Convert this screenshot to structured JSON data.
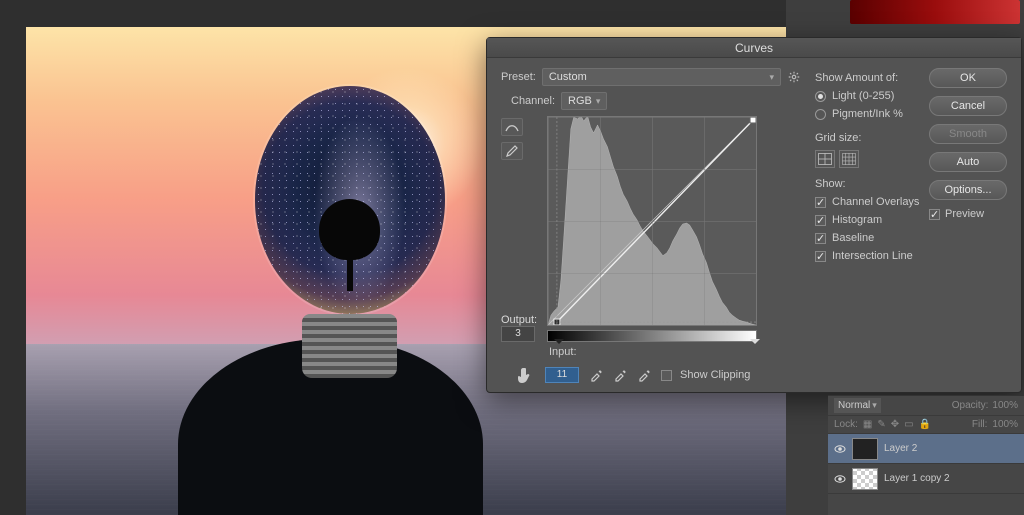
{
  "dialog": {
    "title": "Curves",
    "preset_label": "Preset:",
    "preset_value": "Custom",
    "channel_label": "Channel:",
    "channel_value": "RGB",
    "output_label": "Output:",
    "output_value": "3",
    "input_label": "Input:",
    "input_value": "11",
    "show_clipping_label": "Show Clipping",
    "show_clipping_checked": false
  },
  "amount": {
    "title": "Show Amount of:",
    "light_label": "Light  (0-255)",
    "pigment_label": "Pigment/Ink %"
  },
  "gridsize_label": "Grid size:",
  "show": {
    "title": "Show:",
    "channel_overlays": "Channel Overlays",
    "histogram": "Histogram",
    "baseline": "Baseline",
    "intersection": "Intersection Line"
  },
  "buttons": {
    "ok": "OK",
    "cancel": "Cancel",
    "smooth": "Smooth",
    "auto": "Auto",
    "options": "Options...",
    "preview": "Preview"
  },
  "layers_panel": {
    "blend": "Normal",
    "opacity_label": "Opacity:",
    "opacity_value": "100%",
    "lock_label": "Lock:",
    "fill_label": "Fill:",
    "fill_value": "100%",
    "items": [
      {
        "name": "Layer 2"
      },
      {
        "name": "Layer 1 copy 2"
      }
    ]
  },
  "chart_data": {
    "type": "line",
    "title": "Curves",
    "xlabel": "Input",
    "ylabel": "Output",
    "xlim": [
      0,
      255
    ],
    "ylim": [
      0,
      255
    ],
    "series": [
      {
        "name": "Curve",
        "x": [
          11,
          255
        ],
        "y": [
          3,
          255
        ]
      },
      {
        "name": "Baseline",
        "x": [
          0,
          255
        ],
        "y": [
          0,
          255
        ]
      }
    ],
    "histogram_approx": [
      10,
      15,
      20,
      60,
      120,
      200,
      250,
      245,
      255,
      240,
      250,
      230,
      215,
      200,
      230,
      218,
      200,
      182,
      166,
      150,
      135,
      122,
      110,
      104,
      96,
      90,
      83,
      78,
      72,
      67,
      63,
      58,
      55,
      52,
      50,
      47,
      44,
      42,
      44,
      50,
      58,
      66,
      72,
      78,
      80,
      78,
      72,
      65,
      58,
      50,
      44,
      36,
      30,
      24,
      20,
      16,
      14,
      12,
      10,
      8,
      6,
      5,
      4,
      3
    ]
  }
}
